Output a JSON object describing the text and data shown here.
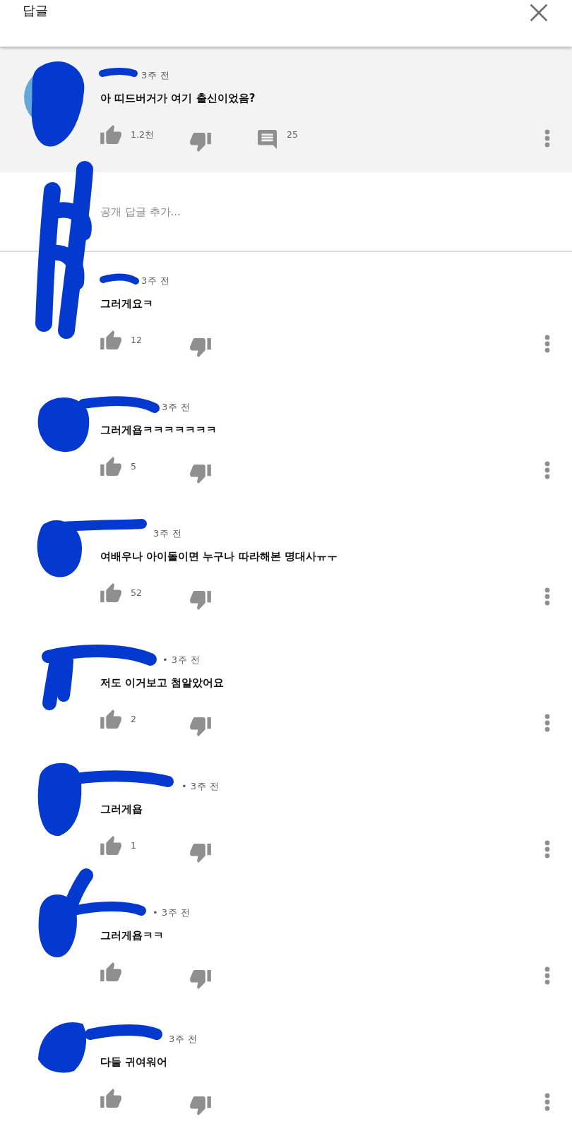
{
  "header": {
    "title": "답글"
  },
  "parent_comment": {
    "meta": "3주 전",
    "text": "아 띠드버거가 여기 출신이었음?",
    "likes": "1.2천",
    "replies": "25"
  },
  "reply_field": {
    "placeholder": "공개 답글 추가..."
  },
  "replies": [
    {
      "meta": "3주 전",
      "text": "그러게요ㅋ",
      "likes": "12"
    },
    {
      "meta": "3주 전",
      "text": "그러게욥ㅋㅋㅋㅋㅋㅋㅋ",
      "likes": "5"
    },
    {
      "meta": "3주 전",
      "text": "여배우나 아이돌이면 누구나 따라해본 명대사ㅠㅜ",
      "likes": "52"
    },
    {
      "meta": "• 3주 전",
      "text": "저도 이거보고 첨알았어요",
      "likes": "2"
    },
    {
      "meta": "• 3주 전",
      "text": "그러게욥",
      "likes": "1"
    },
    {
      "meta": "• 3주 전",
      "text": "그러게욥ㅋㅋ"
    },
    {
      "meta": "3주 전",
      "text": "다들 귀여워어"
    }
  ]
}
